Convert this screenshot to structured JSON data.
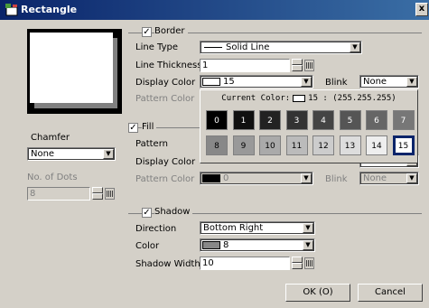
{
  "window": {
    "title": "Rectangle",
    "close_label": "x"
  },
  "left": {
    "chamfer_label": "Chamfer",
    "chamfer_value": "None",
    "dots_label": "No. of Dots",
    "dots_value": "8"
  },
  "border": {
    "group_label": "Border",
    "checked": true,
    "line_type_label": "Line Type",
    "line_type_value": "Solid Line",
    "thickness_label": "Line Thickness",
    "thickness_value": "1",
    "display_color_label": "Display Color",
    "display_color_value": "15",
    "display_color_swatch": "#ffffff",
    "blink_label": "Blink",
    "blink_value": "None",
    "pattern_color_label": "Pattern Color"
  },
  "fill": {
    "group_label": "Fill",
    "checked": true,
    "pattern_label": "Pattern",
    "display_color_label": "Display Color",
    "pattern_color_label": "Pattern Color",
    "pattern_color_value": "0",
    "pattern_color_swatch": "#000000",
    "blink_label": "Blink",
    "blink_value": "None",
    "blink_value_disabled": "None"
  },
  "palette": {
    "current_label": "Current Color:",
    "current_value": "15 : (255.255.255)",
    "cells": [
      {
        "label": "0",
        "color": "#000000",
        "text": "#ffffff"
      },
      {
        "label": "1",
        "color": "#101010",
        "text": "#ffffff"
      },
      {
        "label": "2",
        "color": "#222222",
        "text": "#ffffff"
      },
      {
        "label": "3",
        "color": "#333333",
        "text": "#ffffff"
      },
      {
        "label": "4",
        "color": "#444444",
        "text": "#ffffff"
      },
      {
        "label": "5",
        "color": "#555555",
        "text": "#ffffff"
      },
      {
        "label": "6",
        "color": "#666666",
        "text": "#ffffff"
      },
      {
        "label": "7",
        "color": "#777777",
        "text": "#ffffff"
      },
      {
        "label": "8",
        "color": "#888888",
        "text": "#000000"
      },
      {
        "label": "9",
        "color": "#999999",
        "text": "#000000"
      },
      {
        "label": "10",
        "color": "#aaaaaa",
        "text": "#000000"
      },
      {
        "label": "11",
        "color": "#bbbbbb",
        "text": "#000000"
      },
      {
        "label": "12",
        "color": "#cccccc",
        "text": "#000000"
      },
      {
        "label": "13",
        "color": "#dddddd",
        "text": "#000000"
      },
      {
        "label": "14",
        "color": "#eeeeee",
        "text": "#000000"
      },
      {
        "label": "15",
        "color": "#ffffff",
        "text": "#000000",
        "selected": true
      }
    ]
  },
  "shadow": {
    "group_label": "Shadow",
    "checked": true,
    "direction_label": "Direction",
    "direction_value": "Bottom Right",
    "color_label": "Color",
    "color_value": "8",
    "color_swatch": "#888888",
    "width_label": "Shadow Width",
    "width_value": "10"
  },
  "buttons": {
    "ok": "OK (O)",
    "cancel": "Cancel"
  },
  "colors": {
    "titlebar": "#0a246a",
    "face": "#d4d0c8",
    "selection": "#0a246a"
  }
}
